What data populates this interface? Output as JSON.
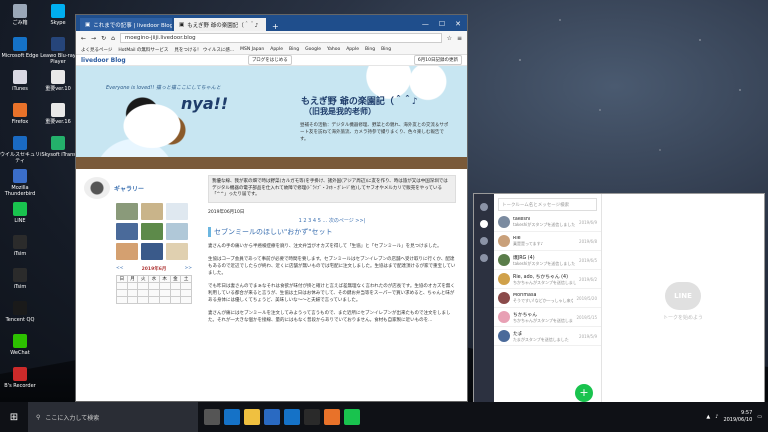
{
  "desktop_icons": [
    {
      "label": "ごみ箱",
      "color": "#9aa7b8"
    },
    {
      "label": "Skype",
      "color": "#00aff0"
    },
    {
      "label": "Microsoft Edge",
      "color": "#1572c7"
    },
    {
      "label": "Leawo Blu-ray Player",
      "color": "#26457a"
    },
    {
      "label": "iTunes",
      "color": "#d9d9e3"
    },
    {
      "label": "重要ver.10",
      "color": "#e8e8e8"
    },
    {
      "label": "Firefox",
      "color": "#e8722a"
    },
    {
      "label": "重要ver.16",
      "color": "#e8e8e8"
    },
    {
      "label": "ウイルスセキュリティ",
      "color": "#1a6ac2"
    },
    {
      "label": "iSkysoft iTrans",
      "color": "#24b06b"
    },
    {
      "label": "Mozilla Thunderbird",
      "color": "#3b6ec9"
    },
    {
      "label": "LINE",
      "color": "#19c34e"
    },
    {
      "label": "iTsim",
      "color": "#2b2b2b"
    },
    {
      "label": "iTsim",
      "color": "#2b2b2b"
    },
    {
      "label": "Tencent QQ",
      "color": "#1a1a1a"
    },
    {
      "label": "WeChat",
      "color": "#2dc100"
    },
    {
      "label": "B's Recorder",
      "color": "#cc2a2a"
    }
  ],
  "browser": {
    "tabs": [
      "これまでの記事 | livedoor Blog",
      "もえぎ野 爺の楽園記（＾＾♪"
    ],
    "url": "moegino-jiiji.livedoor.blog",
    "bookmarks": [
      "よく見るページ",
      "HotMail の無料サービス",
      "見をつける！ ウイルスに感...",
      "MSN Japan",
      "Apple",
      "Bing",
      "Google",
      "Yahoo",
      "Apple",
      "Bing",
      "Bing"
    ],
    "livedoor_bar": {
      "logo": "livedoor Blog",
      "right1": "ブログをはじめる",
      "right2": "6月10日記録の更新"
    },
    "header": {
      "catch1": "Everyone is loved!! 猫っと猫ここにしてちゃんと",
      "catch2": "nya!!",
      "title": "もえぎ野 爺の楽園記（＾＾♪",
      "subtitle": "（旧我是我的老师）",
      "desc": "昼補その活動：デジタル機器修理、野菜との親れ、海外友との交流＆サポート友を訪ねて海外旅流、カメラ持参で撮りまくり、色々楽しむ報告です。"
    },
    "sidebar": {
      "gallery_label": "ギャラリー",
      "cal_prev": "<<",
      "cal_title": "2019年6月",
      "cal_next": ">>",
      "cal_days": [
        "日",
        "月",
        "火",
        "水",
        "木",
        "金",
        "土"
      ]
    },
    "notice": "我優な線、我が家の畑で時は野菜(カルガモ等)を手掛け、諸外国(アジア周辺)に友を作り、時は旅が又は中国深圳ではデジタル機器の電子部品を仕入れて故障で修理(ﾄﾞﾗｲﾌﾞ・ｽﾏﾎ・ｶﾞﾚｰｼﾞ他)してヤフオやメルカリで販売をやっている「^^」ったり届です。",
    "post_date": "2019年06月10日",
    "pager": "1 2 3 4 5 ... 次のページ >>|",
    "post_title": "セブンミールのほしい\"おかず\"セット",
    "body": [
      "妻さんの手の痛いから半癌検症療を廃り、注文弁当がオカズを得して「生協」と「セブンミール」を見つけました。",
      "生協はコープ会員であって事前が必要で時間を要します。セブンミールはセブンイレブンの店舗へ受け取りに行くか、配達もあるので近辺でしたらが終わ、近くに店舗が無いものでは宅配に注文しました。生協はまで配達頂けるが家で重宝していました。",
      "でも昨日は妻さんのでまぁなそれは食欲が味付が掛と確けと言えば差無理なく言われたのが店長です。生協のオカズを無く利用している都合が来ると言うが、生協は土日はお休みでして、その鍵お弁当等をスーパーで買い求めると、ちゃんと味がある身体には優しくてちょうど、美味しいな〜〜と夫婦で言っていました。",
      "妻さんが痛にはセブンミールを注文してみようって言うもので、また近所にセブンイレブンが出来たもので注文をしました。それが一大きな個かを接線、量的にはもなく普段からありでいておりません。食材も自家製に近いものを..."
    ]
  },
  "line": {
    "search_placeholder": "トークルーム名とメッセージ検索",
    "chats": [
      {
        "name": "takeshi",
        "msg": "takeshiがスタンプを送信しました",
        "date": "2019/6/9",
        "color": "#7b8ba0"
      },
      {
        "name": "Rie",
        "msg": "乗是是ってます♪",
        "date": "2019/6/8",
        "color": "#c9a07a"
      },
      {
        "name": "爆JRG (4)",
        "msg": "takeshiがスタンプを送信しました",
        "date": "2019/6/5",
        "color": "#5a7d4a"
      },
      {
        "name": "Rie, ado, ちかちゃん (4)",
        "msg": "ちかちゃんがスタンプを送信しました",
        "date": "2019/6/2",
        "color": "#d0a14a"
      },
      {
        "name": "Morimasa",
        "msg": "そうですい!などか一っしゃし来ないな話合いですよ",
        "date": "2019/5/20",
        "color": "#8a4a4a"
      },
      {
        "name": "ちかちゃん",
        "msg": "ちかちゃんがスタンプを送信しました",
        "date": "2019/5/15",
        "color": "#e8a0b4"
      },
      {
        "name": "たま",
        "msg": "たまがスタンプを送信しました",
        "date": "2019/5/9",
        "color": "#4a6a9a"
      }
    ],
    "empty_logo": "LINE",
    "empty_text": "トークを始めよう"
  },
  "taskbar": {
    "search": "ここに入力して検索",
    "time": "9:57",
    "date": "2019/06/10"
  }
}
